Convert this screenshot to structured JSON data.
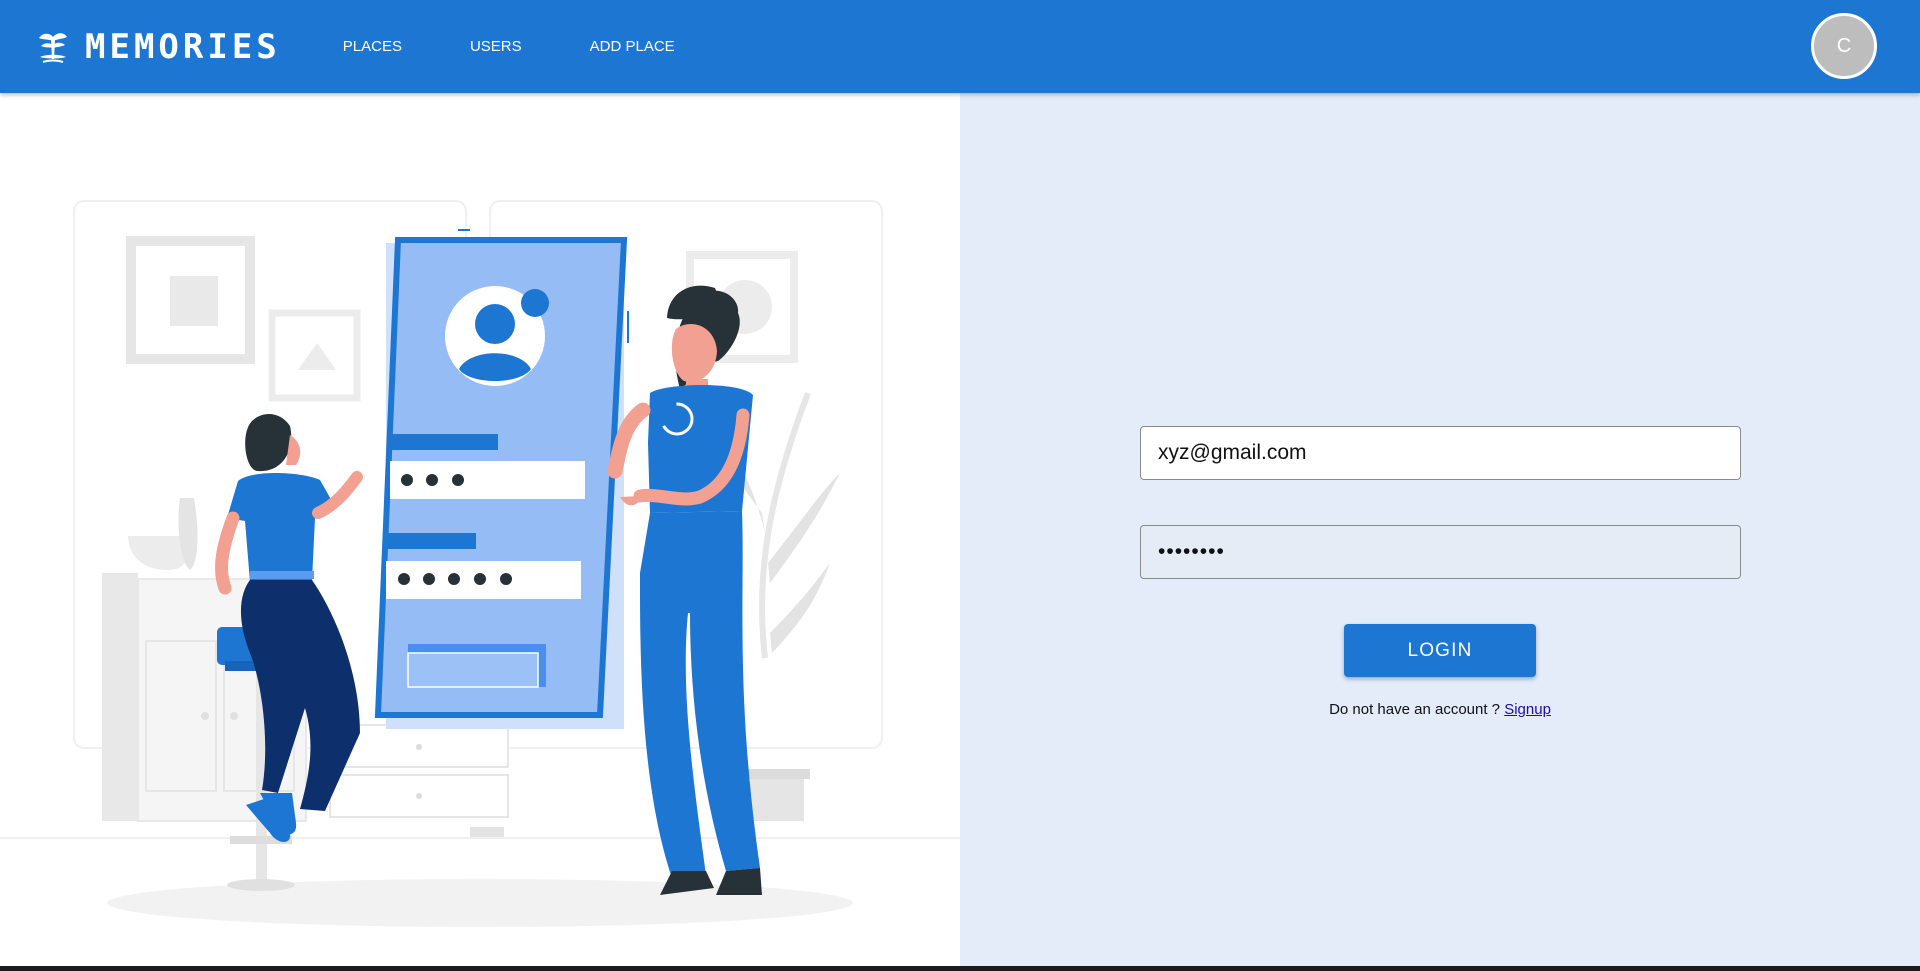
{
  "brand": {
    "name": "MEMORIES",
    "logo_icon": "tree-logo-icon"
  },
  "nav": {
    "links": [
      "PLACES",
      "USERS",
      "ADD PLACE"
    ]
  },
  "avatar": {
    "initial": "C"
  },
  "illustration": {
    "name": "login-illustration"
  },
  "form": {
    "email_value": "xyz@gmail.com",
    "password_value": "••••••••",
    "login_label": "LOGIN",
    "signup_prompt": "Do not have an account ?",
    "signup_link": "Signup"
  },
  "colors": {
    "primary": "#1c76d2",
    "panel_background": "#e3ecf8",
    "link": "#1a0dab",
    "avatar": "#bdbdbd"
  }
}
